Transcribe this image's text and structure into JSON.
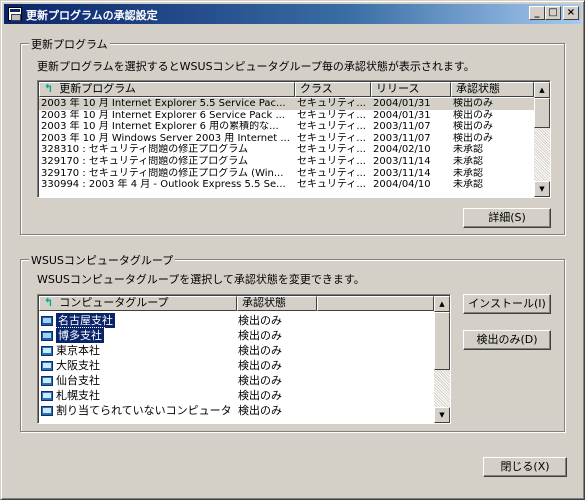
{
  "window": {
    "title": "更新プログラムの承認設定",
    "buttons": {
      "minimize": "_",
      "maximize": "□",
      "close": "×"
    }
  },
  "updates_group": {
    "legend": "更新プログラム",
    "description": "更新プログラムを選択するとWSUSコンピュータグループ毎の承認状態が表示されます。",
    "columns": [
      "更新プログラム",
      "クラス",
      "リリース",
      "承認状態"
    ],
    "rows": [
      [
        "2003 年 10 月 Internet Explorer 5.5 Service Pac...",
        "セキュリティ...",
        "2004/01/31",
        "検出のみ"
      ],
      [
        "2003 年 10 月 Internet Explorer 6 Service Pack ...",
        "セキュリティ...",
        "2004/01/31",
        "検出のみ"
      ],
      [
        "2003 年 10 月 Internet Explorer 6 用の累積的な...",
        "セキュリティ...",
        "2003/11/07",
        "検出のみ"
      ],
      [
        "2003 年 10 月 Windows Server 2003 用 Internet ...",
        "セキュリティ...",
        "2003/11/07",
        "検出のみ"
      ],
      [
        "328310 : セキュリティ問題の修正プログラム",
        "セキュリティ...",
        "2004/02/10",
        "未承認"
      ],
      [
        "329170 : セキュリティ問題の修正プログラム",
        "セキュリティ...",
        "2003/11/14",
        "未承認"
      ],
      [
        "329170 : セキュリティ問題の修正プログラム (Win...",
        "セキュリティ...",
        "2003/11/14",
        "未承認"
      ],
      [
        "330994 : 2003 年 4 月 - Outlook Express 5.5 Se...",
        "セキュリティ...",
        "2004/04/10",
        "未承認"
      ]
    ],
    "details_button": "詳細(S)"
  },
  "groups_group": {
    "legend": "WSUSコンピュータグループ",
    "description": "WSUSコンピュータグループを選択して承認状態を変更できます。",
    "columns": [
      "コンピュータグループ",
      "承認状態"
    ],
    "rows": [
      [
        "名古屋支社",
        "検出のみ"
      ],
      [
        "博多支社",
        "検出のみ"
      ],
      [
        "東京本社",
        "検出のみ"
      ],
      [
        "大阪支社",
        "検出のみ"
      ],
      [
        "仙台支社",
        "検出のみ"
      ],
      [
        "札幌支社",
        "検出のみ"
      ],
      [
        "割り当てられていないコンピュータ",
        "検出のみ"
      ]
    ],
    "install_button": "インストール(I)",
    "detect_button": "検出のみ(D)"
  },
  "close_button": "閉じる(X)"
}
